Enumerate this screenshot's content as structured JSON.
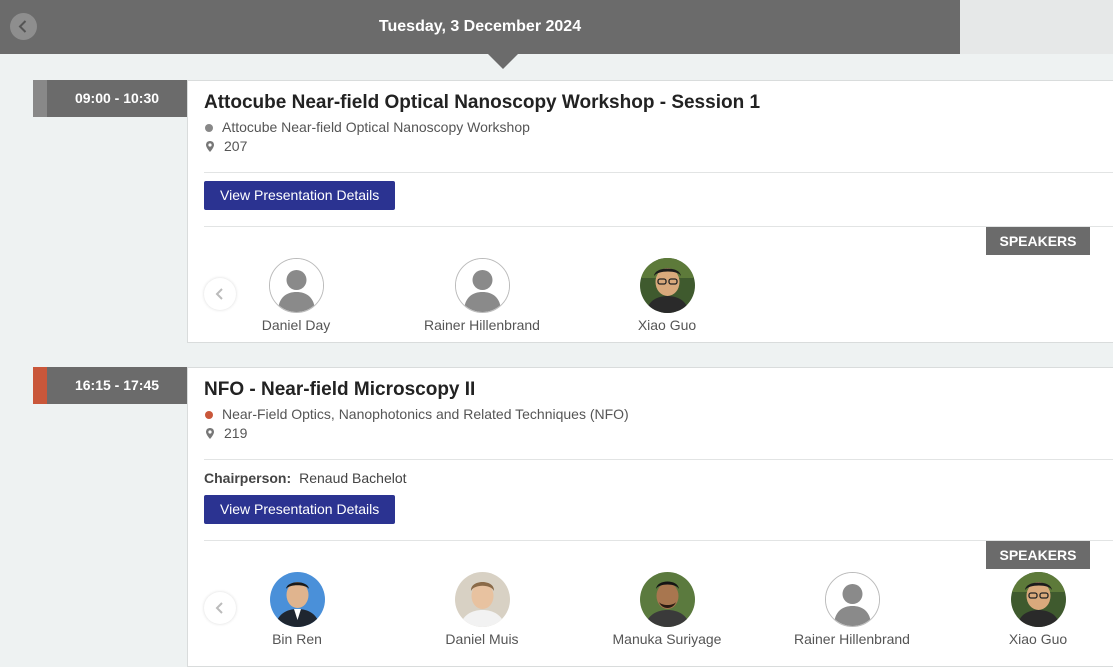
{
  "header": {
    "date": "Tuesday, 3 December 2024"
  },
  "sessions": [
    {
      "time": "09:00 - 10:30",
      "stripe_color": "#888888",
      "title": "Attocube Near-field Optical Nanoscopy Workshop - Session 1",
      "track": "Attocube Near-field Optical Nanoscopy Workshop",
      "track_color": "#888888",
      "room": "207",
      "button_label": "View Presentation Details",
      "speakers_label": "SPEAKERS",
      "speakers": [
        {
          "name": "Daniel Day",
          "avatar": "placeholder-avatar-icon"
        },
        {
          "name": "Rainer Hillenbrand",
          "avatar": "placeholder-avatar-icon"
        },
        {
          "name": "Xiao Guo",
          "avatar": "photo"
        }
      ]
    },
    {
      "time": "16:15 - 17:45",
      "stripe_color": "#c9573a",
      "title": "NFO - Near-field Microscopy II",
      "track": "Near-Field Optics, Nanophotonics and Related Techniques (NFO)",
      "track_color": "#c9573a",
      "room": "219",
      "chair_label": "Chairperson:",
      "chair_name": "Renaud Bachelot",
      "button_label": "View Presentation Details",
      "speakers_label": "SPEAKERS",
      "speakers": [
        {
          "name": "Bin Ren",
          "avatar": "photo"
        },
        {
          "name": "Daniel Muis",
          "avatar": "photo"
        },
        {
          "name": "Manuka Suriyage",
          "avatar": "photo"
        },
        {
          "name": "Rainer Hillenbrand",
          "avatar": "placeholder-avatar-icon"
        },
        {
          "name": "Xiao Guo",
          "avatar": "photo"
        }
      ]
    }
  ],
  "colors": {
    "header_bg": "#6b6b6b",
    "button_bg": "#2b3391",
    "page_bg": "#eef2f2"
  }
}
